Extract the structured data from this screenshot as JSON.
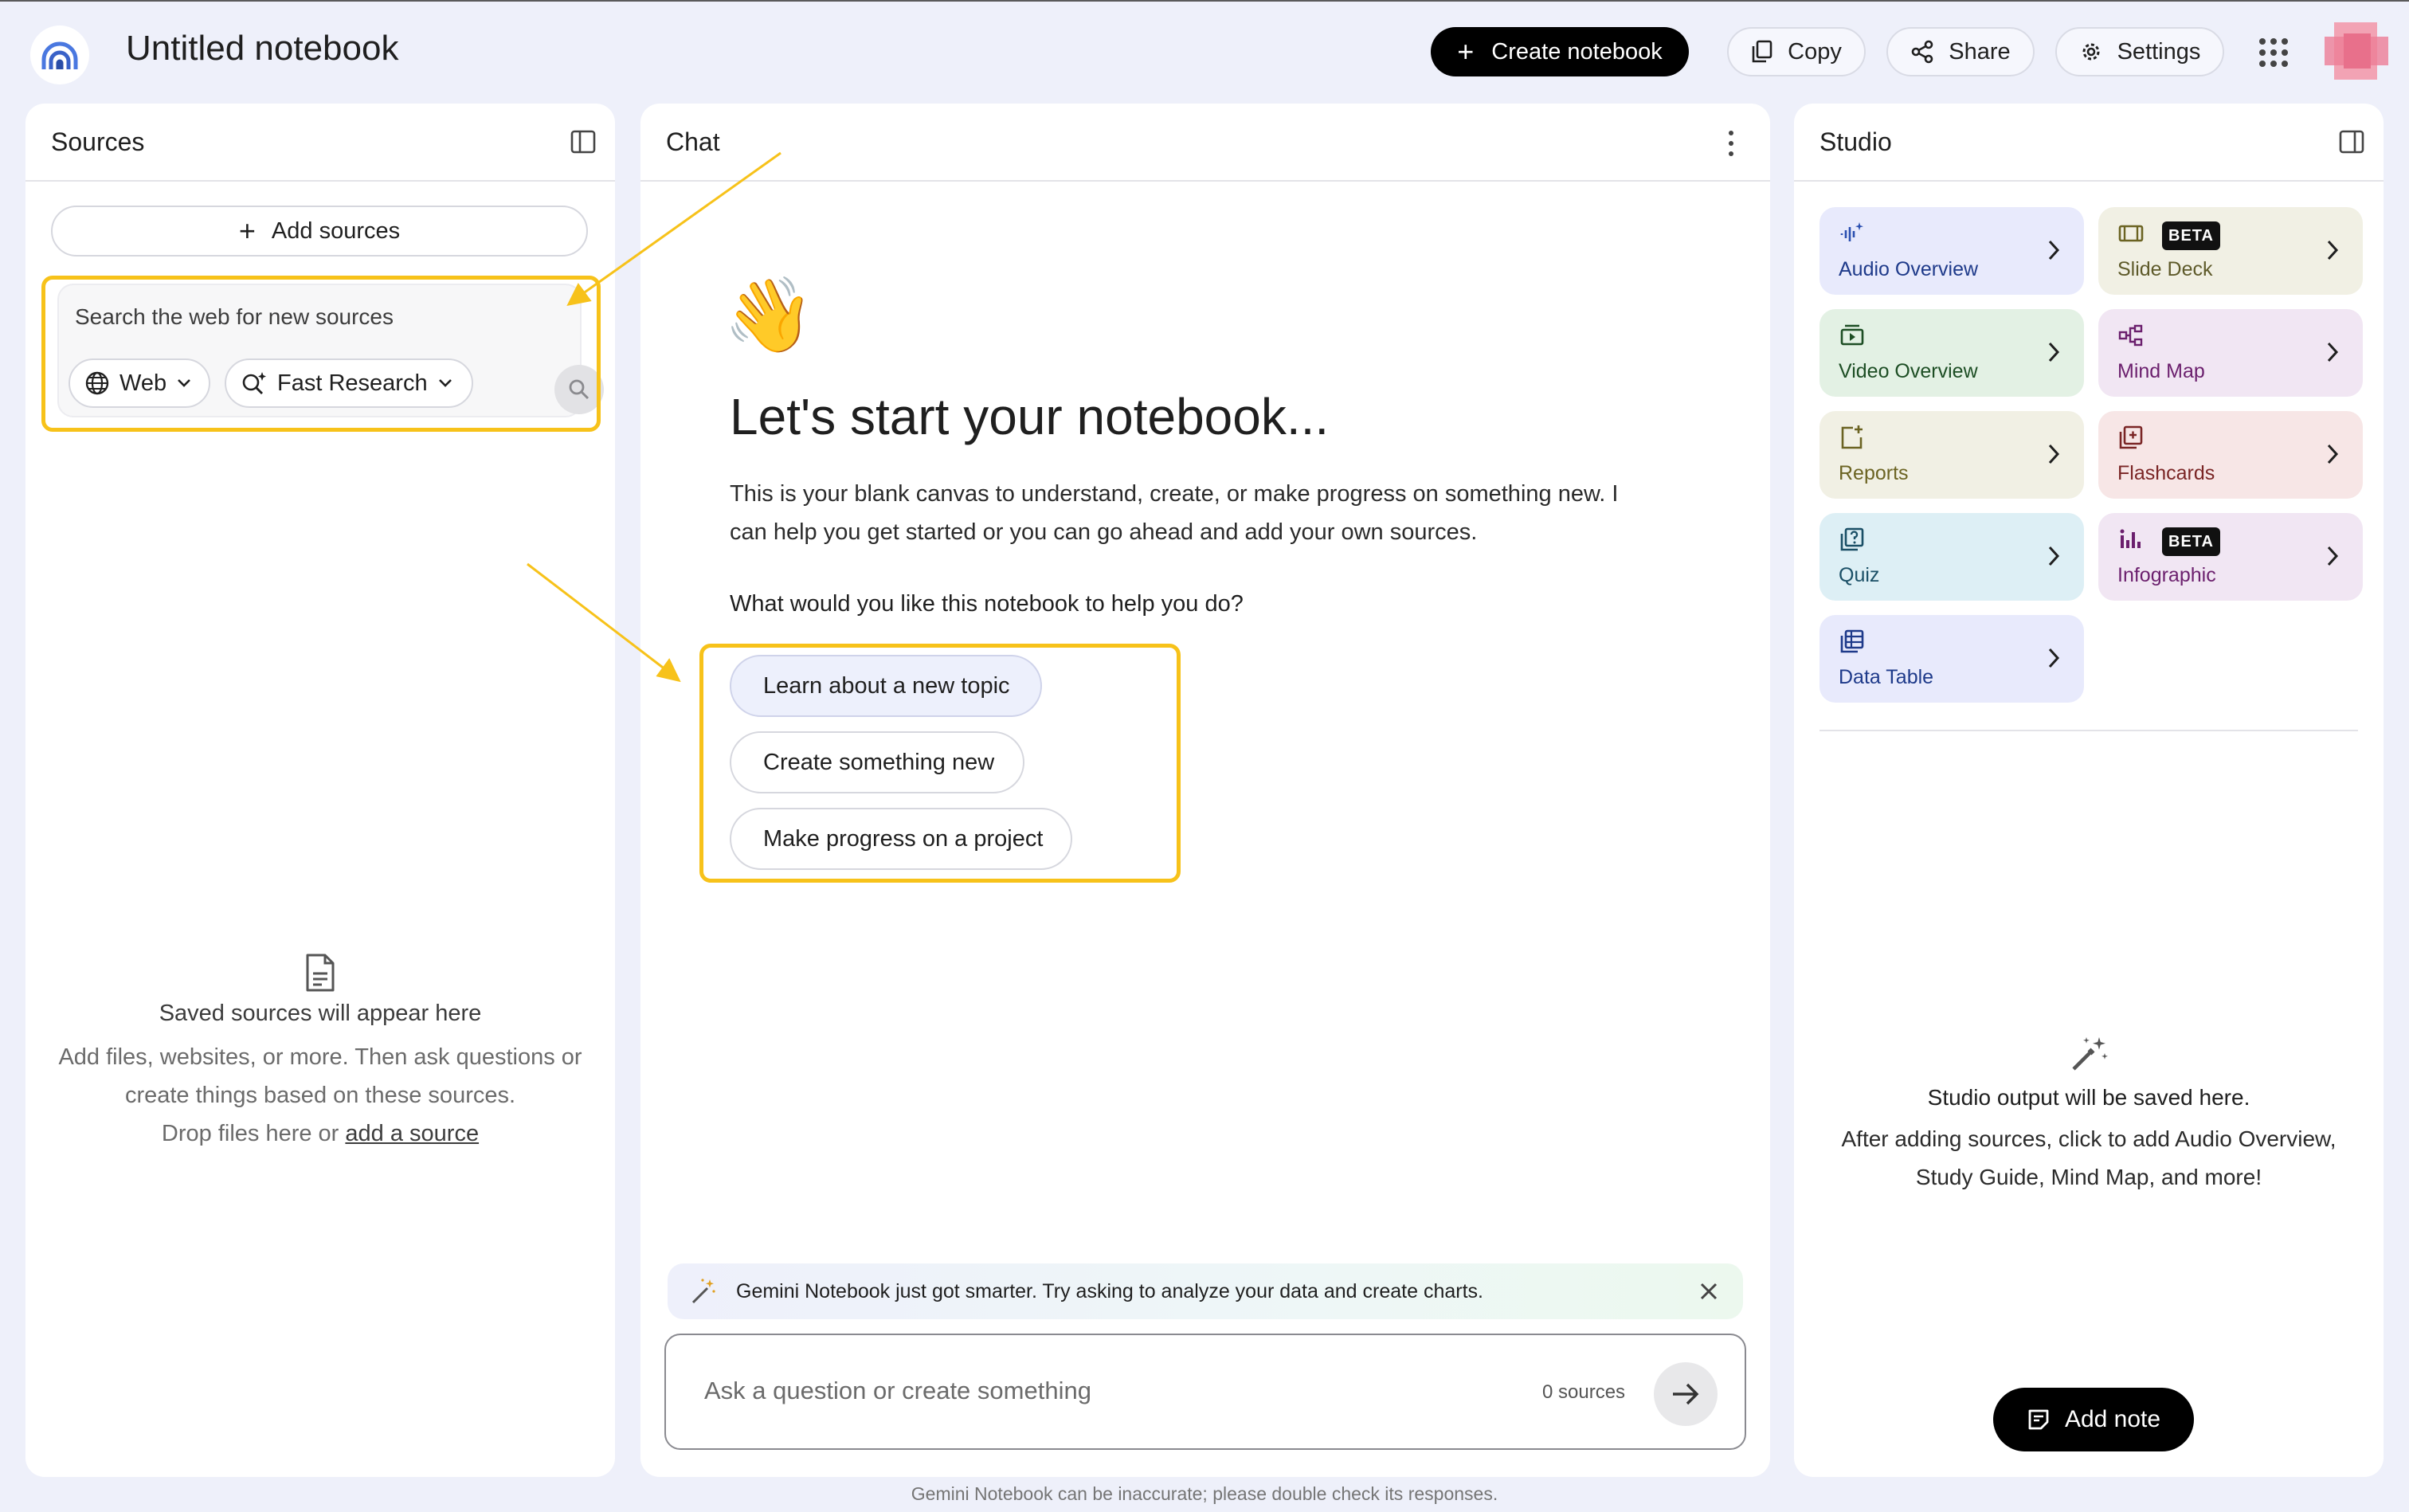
{
  "header": {
    "notebook_title": "Untitled notebook",
    "create_label": "Create notebook",
    "copy_label": "Copy",
    "share_label": "Share",
    "settings_label": "Settings"
  },
  "sources": {
    "title": "Sources",
    "add_label": "Add sources",
    "search_placeholder": "Search the web for new sources",
    "web_chip": "Web",
    "research_chip": "Fast Research",
    "empty_title": "Saved sources will appear here",
    "empty_line1": "Add files, websites, or more. Then ask questions or",
    "empty_line2": "create things based on these sources.",
    "empty_line3_prefix": "Drop files here or ",
    "empty_link": "add a source"
  },
  "chat": {
    "title": "Chat",
    "emoji": "👋",
    "heading": "Let's start your notebook...",
    "intro": "This is your blank canvas to understand, create, or make progress on something new. I can help you get started or you can go ahead and add your own sources.",
    "question": "What would you like this notebook to help you do?",
    "options": [
      "Learn about a new topic",
      "Create something new",
      "Make progress on a project"
    ],
    "banner": "Gemini Notebook just got smarter. Try asking to analyze your data and create charts.",
    "input_placeholder": "Ask a question or create something",
    "source_count": "0 sources"
  },
  "studio": {
    "title": "Studio",
    "tiles": [
      {
        "label": "Audio Overview",
        "icon": "audio-waveform-icon"
      },
      {
        "label": "Slide Deck",
        "icon": "slides-icon",
        "badge": "BETA"
      },
      {
        "label": "Video Overview",
        "icon": "video-icon"
      },
      {
        "label": "Mind Map",
        "icon": "mind-map-icon"
      },
      {
        "label": "Reports",
        "icon": "report-icon"
      },
      {
        "label": "Flashcards",
        "icon": "flashcards-icon"
      },
      {
        "label": "Quiz",
        "icon": "quiz-icon"
      },
      {
        "label": "Infographic",
        "icon": "infographic-icon",
        "badge": "BETA"
      },
      {
        "label": "Data Table",
        "icon": "table-icon"
      }
    ],
    "empty_title": "Studio output will be saved here.",
    "empty_line1": "After adding sources, click to add Audio Overview,",
    "empty_line2": "Study Guide, Mind Map, and more!",
    "add_note_label": "Add note"
  },
  "footer": {
    "disclaimer": "Gemini Notebook can be inaccurate; please double check its responses."
  },
  "colors": {
    "background": "#eef0fa",
    "highlight": "#f7c21a",
    "primary_button": "#000000"
  }
}
